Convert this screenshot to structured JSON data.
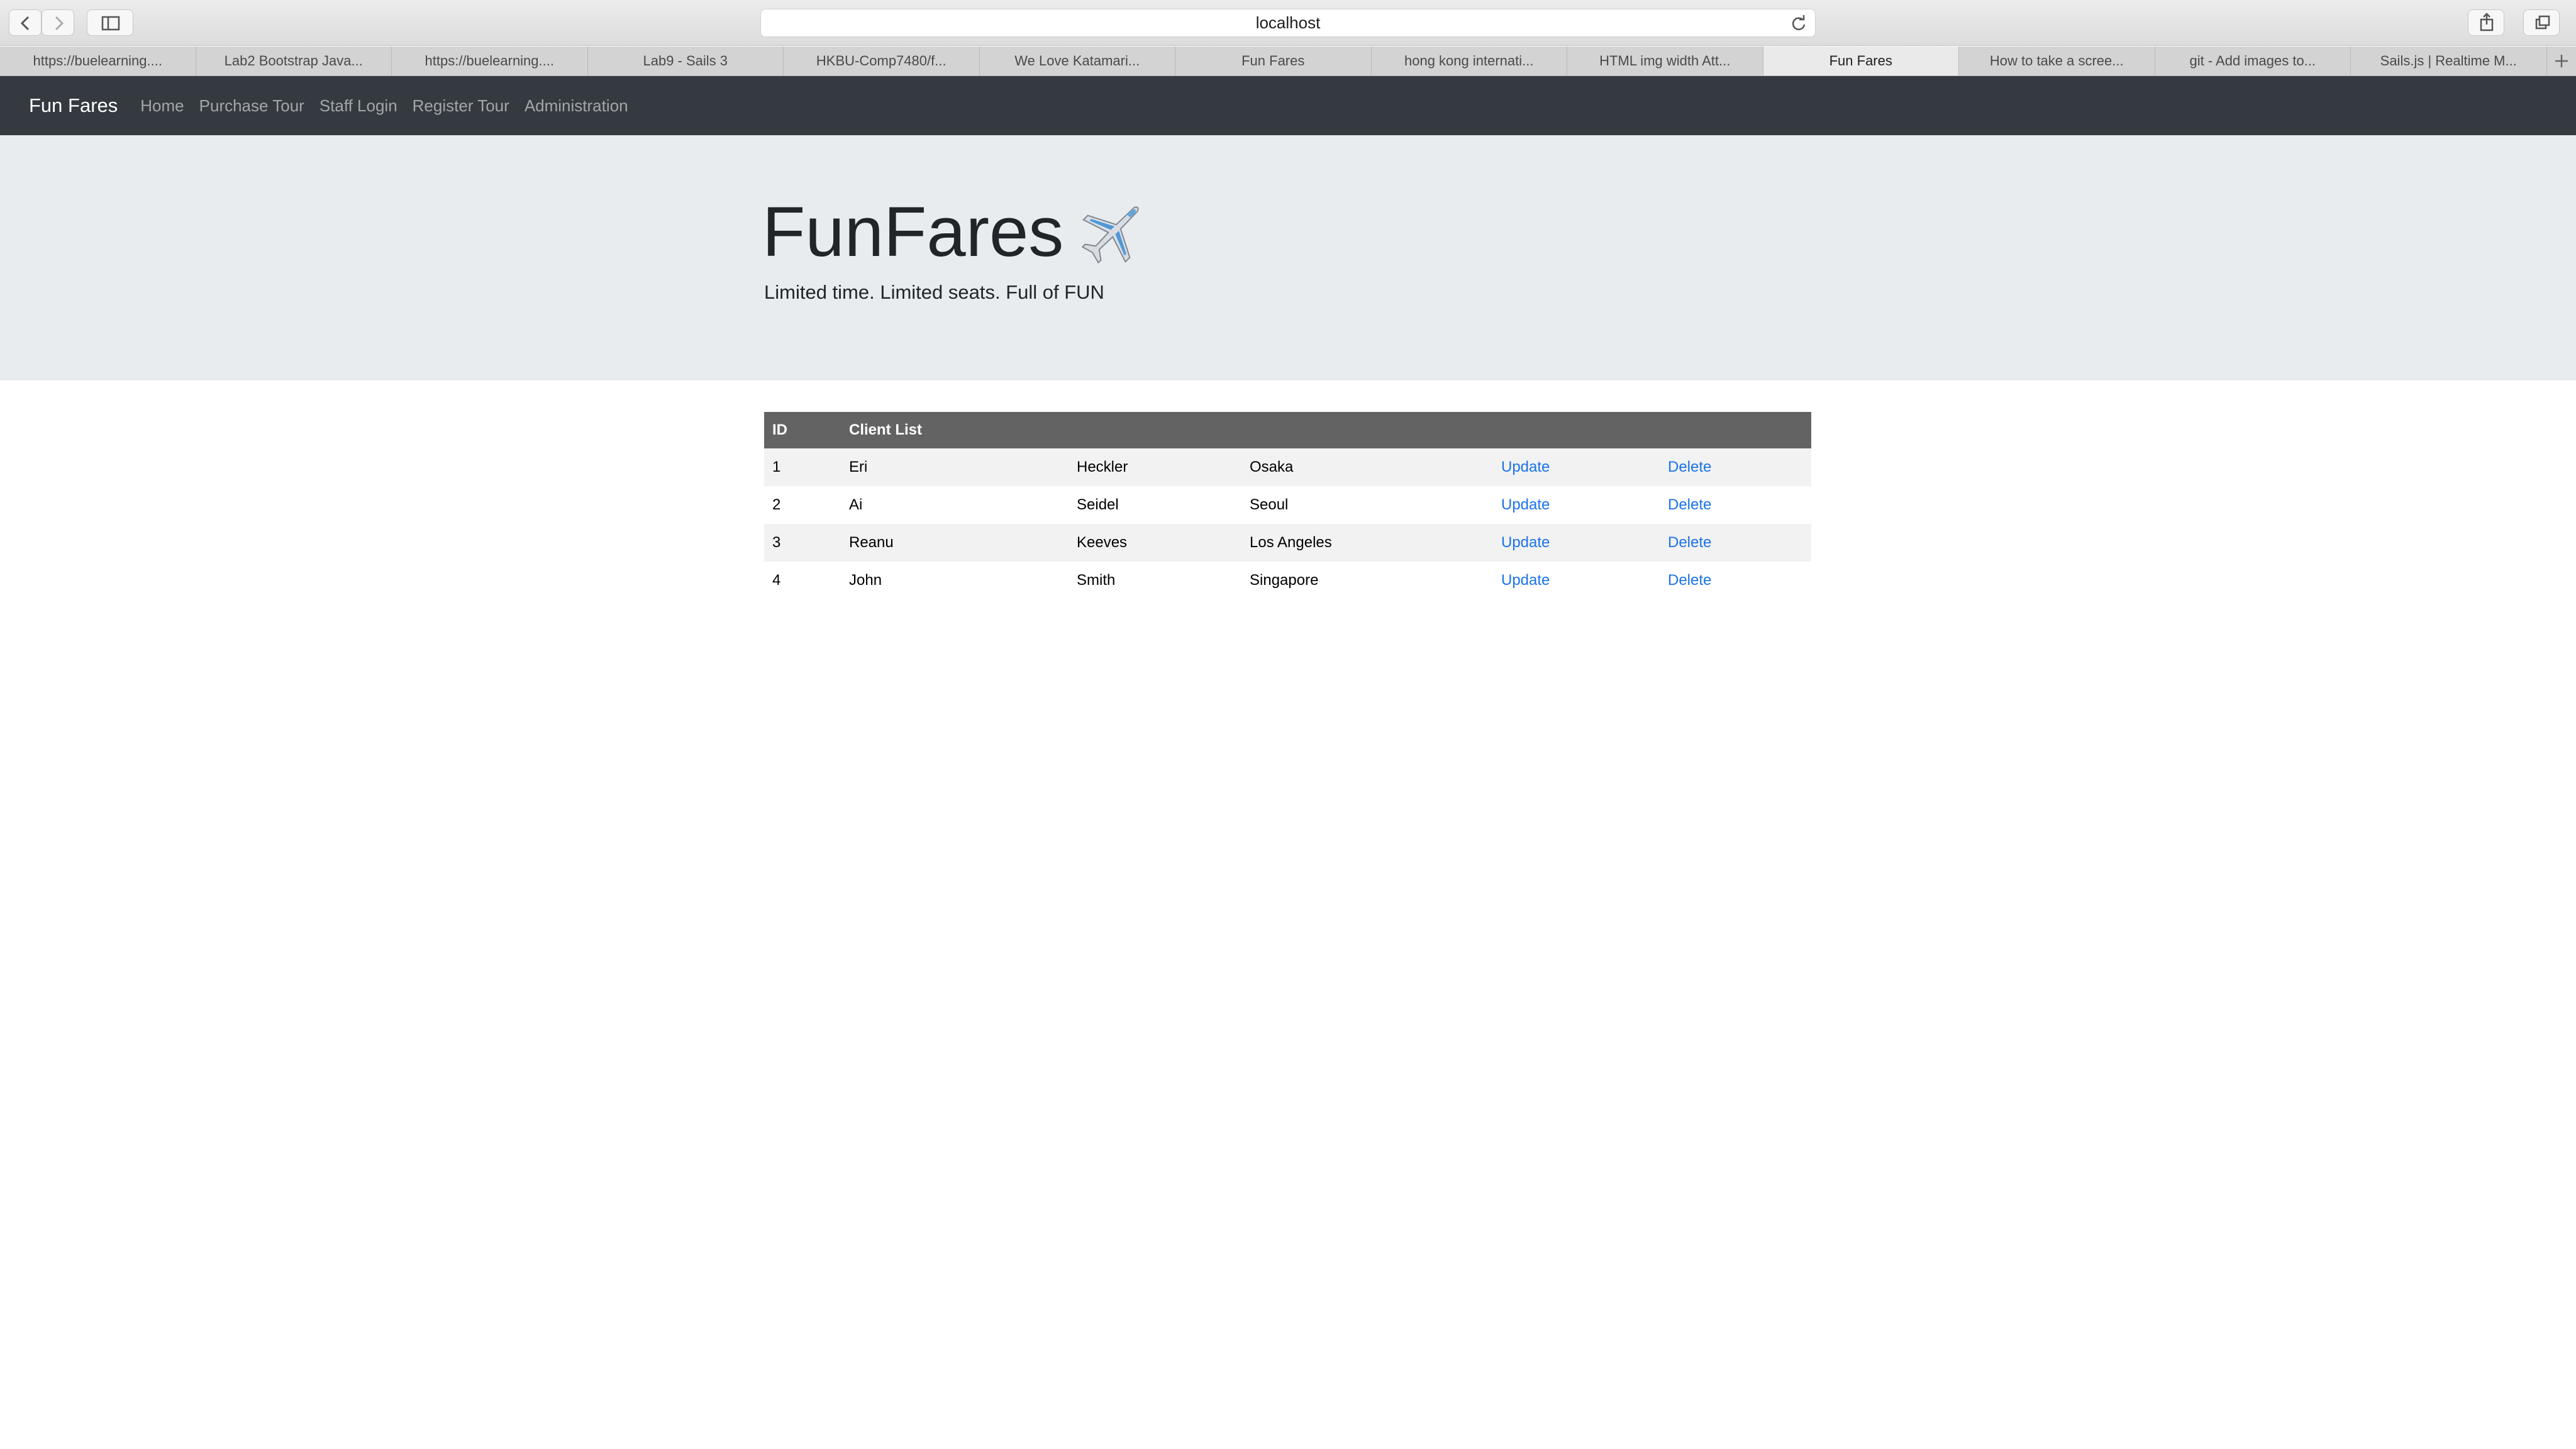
{
  "browser": {
    "url": "localhost",
    "tabs": [
      {
        "label": "https://buelearning...."
      },
      {
        "label": "Lab2 Bootstrap Java..."
      },
      {
        "label": "https://buelearning...."
      },
      {
        "label": "Lab9 - Sails 3"
      },
      {
        "label": "HKBU-Comp7480/f..."
      },
      {
        "label": "We Love Katamari..."
      },
      {
        "label": "Fun Fares"
      },
      {
        "label": "hong kong internati..."
      },
      {
        "label": "HTML img width Att..."
      },
      {
        "label": "Fun Fares",
        "active": true
      },
      {
        "label": "How to take a scree..."
      },
      {
        "label": "git - Add images to..."
      },
      {
        "label": "Sails.js | Realtime M..."
      }
    ]
  },
  "navbar": {
    "brand": "Fun Fares",
    "links": [
      "Home",
      "Purchase Tour",
      "Staff Login",
      "Register Tour",
      "Administration"
    ]
  },
  "hero": {
    "title": "FunFares",
    "subtitle": "Limited time. Limited seats. Full of FUN"
  },
  "table": {
    "headers": [
      "ID",
      "Client List"
    ],
    "rows": [
      {
        "id": "1",
        "first": "Eri",
        "last": "Heckler",
        "city": "Osaka",
        "update": "Update",
        "delete": "Delete"
      },
      {
        "id": "2",
        "first": "Ai",
        "last": "Seidel",
        "city": "Seoul",
        "update": "Update",
        "delete": "Delete"
      },
      {
        "id": "3",
        "first": "Reanu",
        "last": "Keeves",
        "city": "Los Angeles",
        "update": "Update",
        "delete": "Delete"
      },
      {
        "id": "4",
        "first": "John",
        "last": "Smith",
        "city": "Singapore",
        "update": "Update",
        "delete": "Delete"
      }
    ]
  },
  "colors": {
    "navbar_bg": "#343a40",
    "jumbotron_bg": "#e9ecef",
    "table_header_bg": "#636363",
    "link": "#1a73e8"
  },
  "icons": [
    "back-icon",
    "forward-icon",
    "sidebar-icon",
    "reload-icon",
    "share-icon",
    "tabs-overview-icon",
    "new-tab-icon",
    "airplane-icon"
  ]
}
